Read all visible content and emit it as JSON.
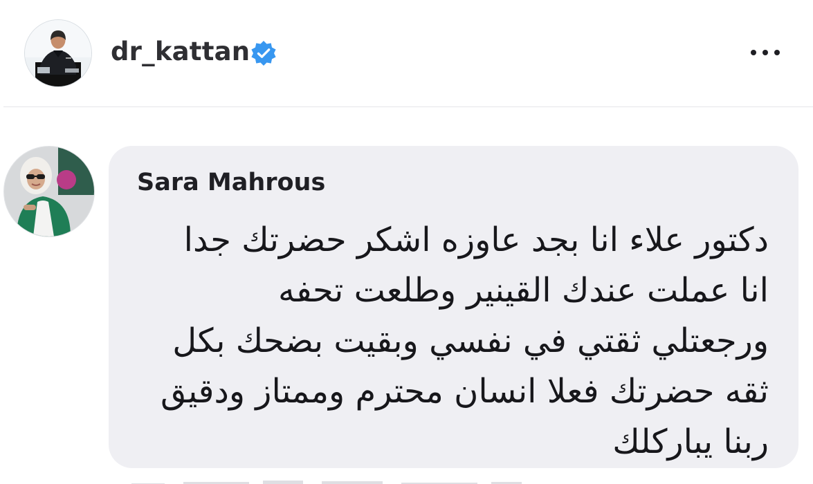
{
  "post": {
    "author": {
      "username": "dr_kattan",
      "verified": true,
      "avatar_icon": "profile-photo"
    },
    "menu_icon": "more-options-icon",
    "comment": {
      "author": "Sara Mahrous",
      "avatar_icon": "profile-photo",
      "lines": [
        "دكتور علاء انا بجد عاوزه اشكر حضرتك جدا",
        "انا عملت عندك القينير وطلعت تحفه",
        "ورجعتلي ثقتي في نفسي وبقيت بضحك بكل",
        "ثقه حضرتك فعلا انسان محترم وممتاز ودقيق",
        "ربنا يباركلك"
      ]
    }
  },
  "colors": {
    "background": "#ffffff",
    "bubble": "#efeff3",
    "verified_badge": "#3897f0",
    "text_primary": "#17171b"
  }
}
